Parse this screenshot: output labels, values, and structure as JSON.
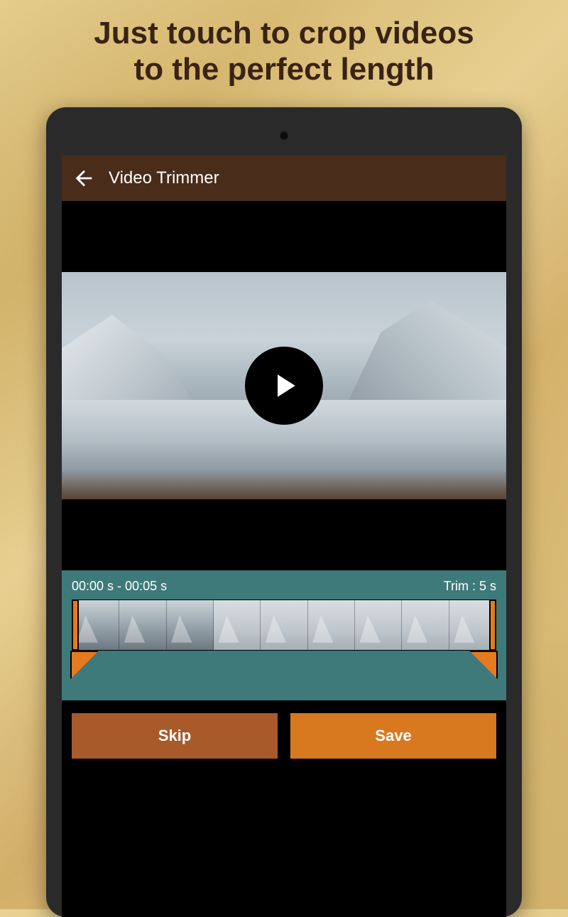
{
  "promo": {
    "headline_line1": "Just touch to crop videos",
    "headline_line2": "to the perfect length"
  },
  "app": {
    "title": "Video Trimmer"
  },
  "trim": {
    "range_label": "00:00 s - 00:05 s",
    "trim_label": "Trim : 5 s"
  },
  "buttons": {
    "skip": "Skip",
    "save": "Save"
  }
}
